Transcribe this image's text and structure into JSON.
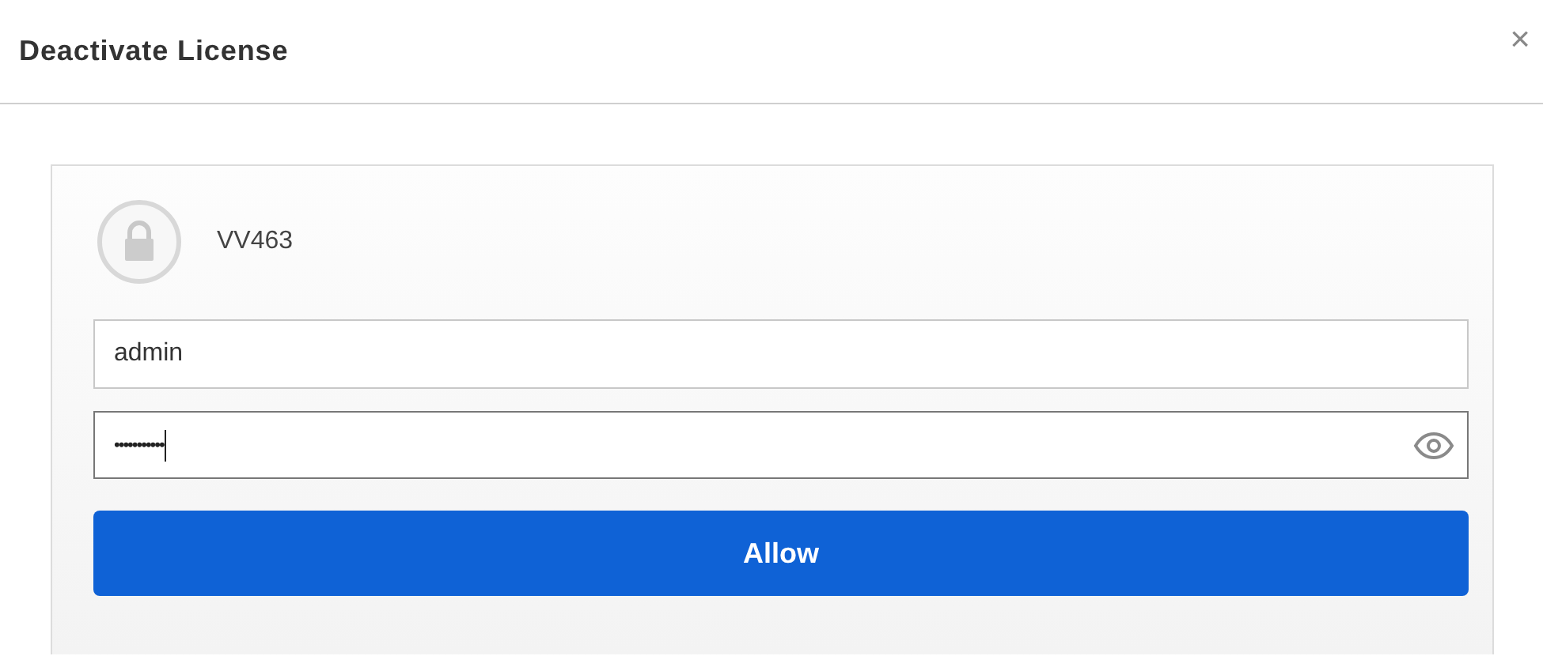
{
  "dialog": {
    "title": "Deactivate License",
    "close": "×"
  },
  "device": {
    "name": "VV463"
  },
  "username": {
    "value": "admin"
  },
  "password": {
    "value": "•••••••••••",
    "focused": true
  },
  "submit": {
    "label": "Allow"
  }
}
